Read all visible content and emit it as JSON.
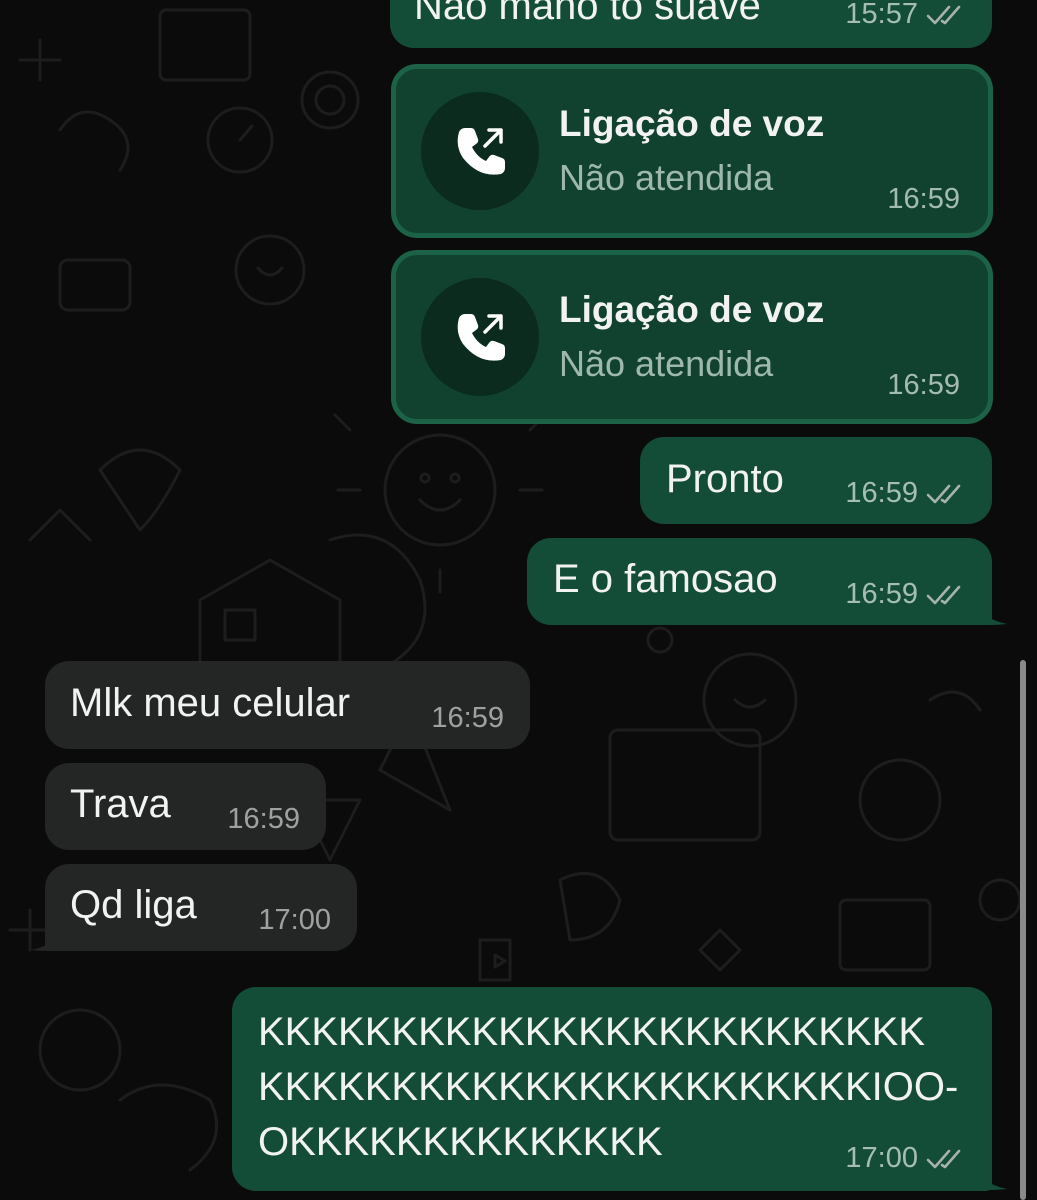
{
  "theme": {
    "outgoing_bubble": "#144d37",
    "incoming_bubble": "#242626",
    "call_bubble": "#11422f",
    "background": "#0b0b0b",
    "read_ticks_color": "#a6b3ad"
  },
  "messages": [
    {
      "direction": "outgoing",
      "text": "Não mano to suave",
      "time": "15:57",
      "status": "read",
      "status_icon": "double-check-icon"
    },
    {
      "direction": "outgoing",
      "type": "call",
      "title": "Ligação de voz",
      "subtitle": "Não atendida",
      "time": "16:59",
      "icon": "outgoing-call-icon"
    },
    {
      "direction": "outgoing",
      "type": "call",
      "title": "Ligação de voz",
      "subtitle": "Não atendida",
      "time": "16:59",
      "icon": "outgoing-call-icon"
    },
    {
      "direction": "outgoing",
      "text": "Pronto",
      "time": "16:59",
      "status": "read",
      "status_icon": "double-check-icon"
    },
    {
      "direction": "outgoing",
      "text": "E o famosao",
      "time": "16:59",
      "status": "read",
      "status_icon": "double-check-icon"
    },
    {
      "direction": "incoming",
      "text": "Mlk meu celular",
      "time": "16:59"
    },
    {
      "direction": "incoming",
      "text": "Trava",
      "time": "16:59"
    },
    {
      "direction": "incoming",
      "text": "Qd liga",
      "time": "17:00"
    },
    {
      "direction": "outgoing",
      "text": "KKKKKKKKKKKKKKKKKKKKKKKKKKKKKKKKKKKKKKKKKKKKKKKKKKIOO-OKKKKKKKKKKKKKK",
      "lines": [
        "KKKKKKKKKKKKKKKKKKKKKKKKK",
        "KKKKKKKKKKKKKKKKKKKKKKKIOO-",
        "OKKKKKKKKKKKKKK"
      ],
      "time": "17:00",
      "status": "read",
      "status_icon": "double-check-icon"
    }
  ]
}
